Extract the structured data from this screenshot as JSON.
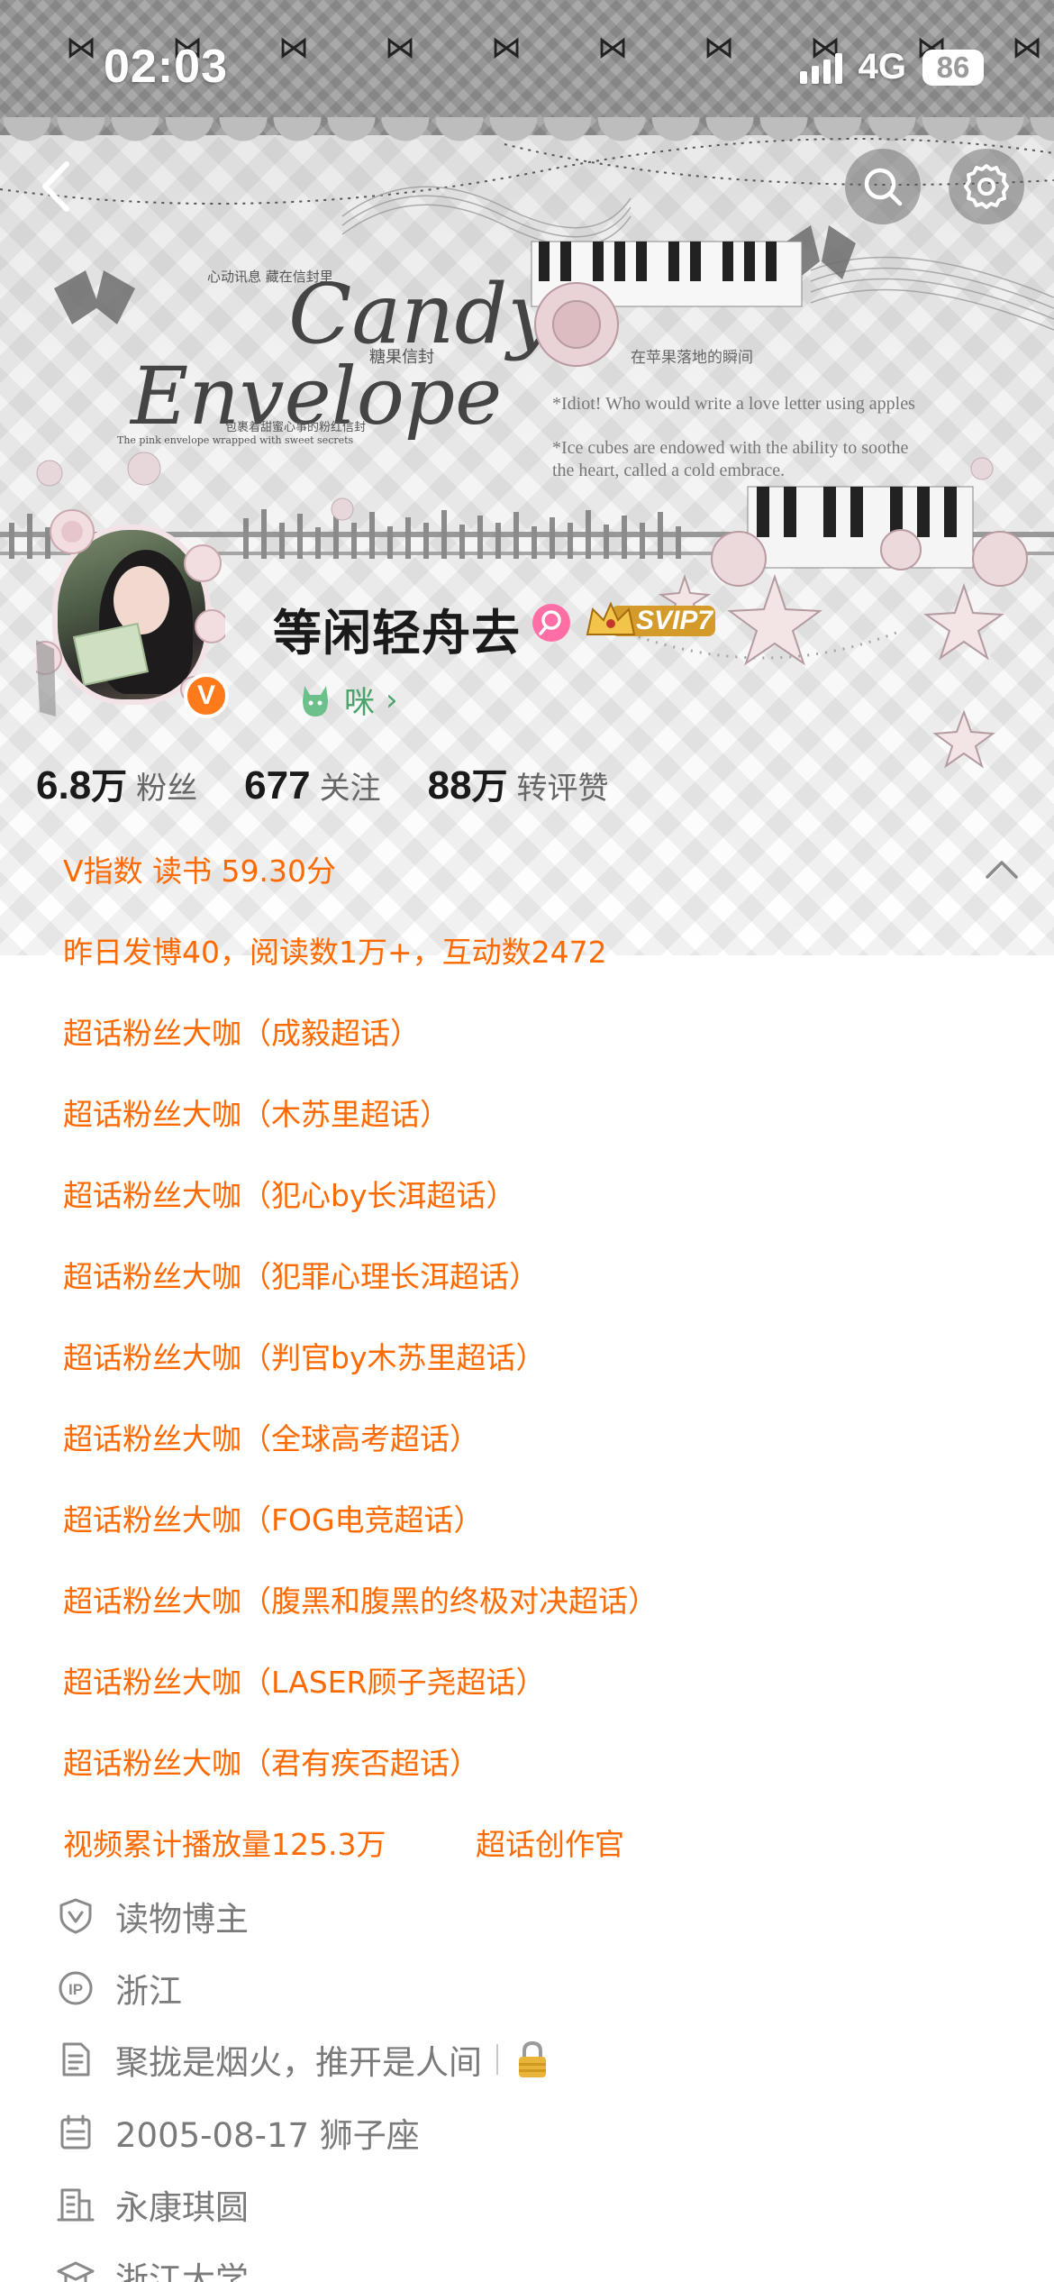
{
  "status_bar": {
    "time": "02:03",
    "network": "4G",
    "battery": "86"
  },
  "header_art": {
    "logo_line1": "Candy",
    "logo_line2": "Envelope",
    "logo_cn": "糖果信封",
    "logo_small_top": "心动讯息 藏在信封里",
    "logo_small_mid": "包裹着甜蜜心事的粉红信封",
    "logo_small_bottom": "The pink envelope wrapped with sweet secrets",
    "quote1_cn": "在苹果落地的瞬间",
    "quote1_en": "*Idiot! Who would write a love letter using apples",
    "quote2_en_line1": "*Ice cubes are endowed with the ability to soothe",
    "quote2_en_line2": "the heart, called a cold embrace."
  },
  "profile": {
    "username": "等闲轻舟去",
    "verified_mark": "V",
    "svip_label": "SVIP7",
    "pet_label": "咪",
    "pet_chevron": "›"
  },
  "stats": [
    {
      "value": "6.8",
      "unit": "万",
      "label": "粉丝"
    },
    {
      "value": "677",
      "unit": "",
      "label": "关注"
    },
    {
      "value": "88",
      "unit": "万",
      "label": "转评赞"
    }
  ],
  "info_lines": [
    "V指数  读书 59.30分",
    "昨日发博40，阅读数1万+，互动数2472",
    "超话粉丝大咖（成毅超话）",
    "超话粉丝大咖（木苏里超话）",
    "超话粉丝大咖（犯心by长洱超话）",
    "超话粉丝大咖（犯罪心理长洱超话）",
    "超话粉丝大咖（判官by木苏里超话）",
    "超话粉丝大咖（全球高考超话）",
    "超话粉丝大咖（FOG电竞超话）",
    "超话粉丝大咖（腹黑和腹黑的终极对决超话）",
    "超话粉丝大咖（LASER顾子尧超话）",
    "超话粉丝大咖（君有疾否超话）"
  ],
  "info_last": {
    "video_plays": "视频累计播放量125.3万",
    "creator": "超话创作官"
  },
  "details": [
    {
      "icon": "shield-v-icon",
      "text": "读物博主"
    },
    {
      "icon": "ip-location-icon",
      "text": "浙江"
    },
    {
      "icon": "bio-document-icon",
      "text": "聚拢是烟火，推开是人间"
    },
    {
      "icon": "calendar-icon",
      "text": "2005-08-17 狮子座"
    },
    {
      "icon": "building-icon",
      "text": "永康琪圆"
    },
    {
      "icon": "graduation-cap-icon",
      "text": "浙江大学"
    }
  ],
  "colors": {
    "accent_orange": "#ff6a00",
    "verified_orange": "#ff7a1a",
    "pet_green": "#4aa36a",
    "text_dark": "#1a1a1a",
    "text_grey": "#7a7a7a"
  }
}
